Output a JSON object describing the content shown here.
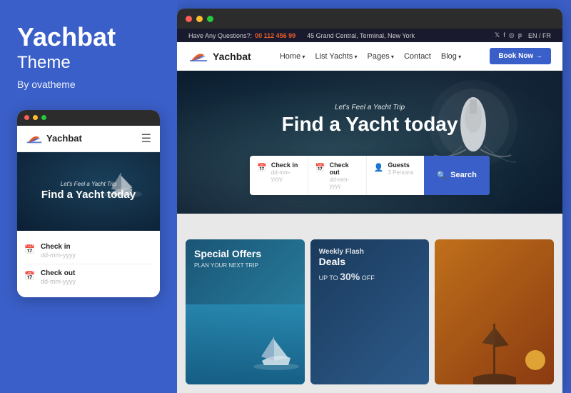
{
  "left": {
    "title": "Yachbat",
    "subtitle": "Theme",
    "by_label": "By ",
    "author": "ovatheme",
    "mobile_dots": [
      "red",
      "yellow",
      "green"
    ],
    "mobile_logo": "Yachbat",
    "mobile_hero_sub": "Let's Feel a Yacht Trip",
    "mobile_hero_title": "Find a Yacht today",
    "form_rows": [
      {
        "label": "Check in",
        "placeholder": "dd-mm-yyyy"
      },
      {
        "label": "Check out",
        "placeholder": "dd-mm-yyyy"
      }
    ]
  },
  "browser": {
    "dots": [
      "red",
      "yellow",
      "green"
    ],
    "topbar": {
      "left_prefix": "Have Any Questions?: ",
      "phone": "00 112 456 99",
      "address": "45 Grand Central, Terminal, New York",
      "lang": "EN / FR"
    },
    "nav": {
      "logo": "Yachbat",
      "links": [
        {
          "label": "Home",
          "has_arrow": true
        },
        {
          "label": "List Yachts",
          "has_arrow": true
        },
        {
          "label": "Pages",
          "has_arrow": true
        },
        {
          "label": "Contact",
          "has_arrow": false
        },
        {
          "label": "Blog",
          "has_arrow": true
        }
      ],
      "book_btn": "Book Now"
    },
    "hero": {
      "sub": "Let's Feel a Yacht Trip",
      "title": "Find a Yacht today"
    },
    "search": {
      "fields": [
        {
          "label": "Check in",
          "placeholder": "dd-mm-yyyy"
        },
        {
          "label": "Check out",
          "placeholder": "dd-mm-yyyy"
        },
        {
          "label": "Guests",
          "placeholder": "3 Persons"
        }
      ],
      "btn_label": "Search"
    },
    "cards": [
      {
        "title": "Special Offers",
        "subtitle": "PLAN YOUR NEXT TRIP",
        "type": "water"
      },
      {
        "pre": "Weekly Flash",
        "title": "Deals",
        "tag_prefix": "UP TO ",
        "highlight": "30%",
        "tag_suffix": " OFF",
        "type": "dark"
      },
      {
        "type": "sunset"
      }
    ]
  }
}
